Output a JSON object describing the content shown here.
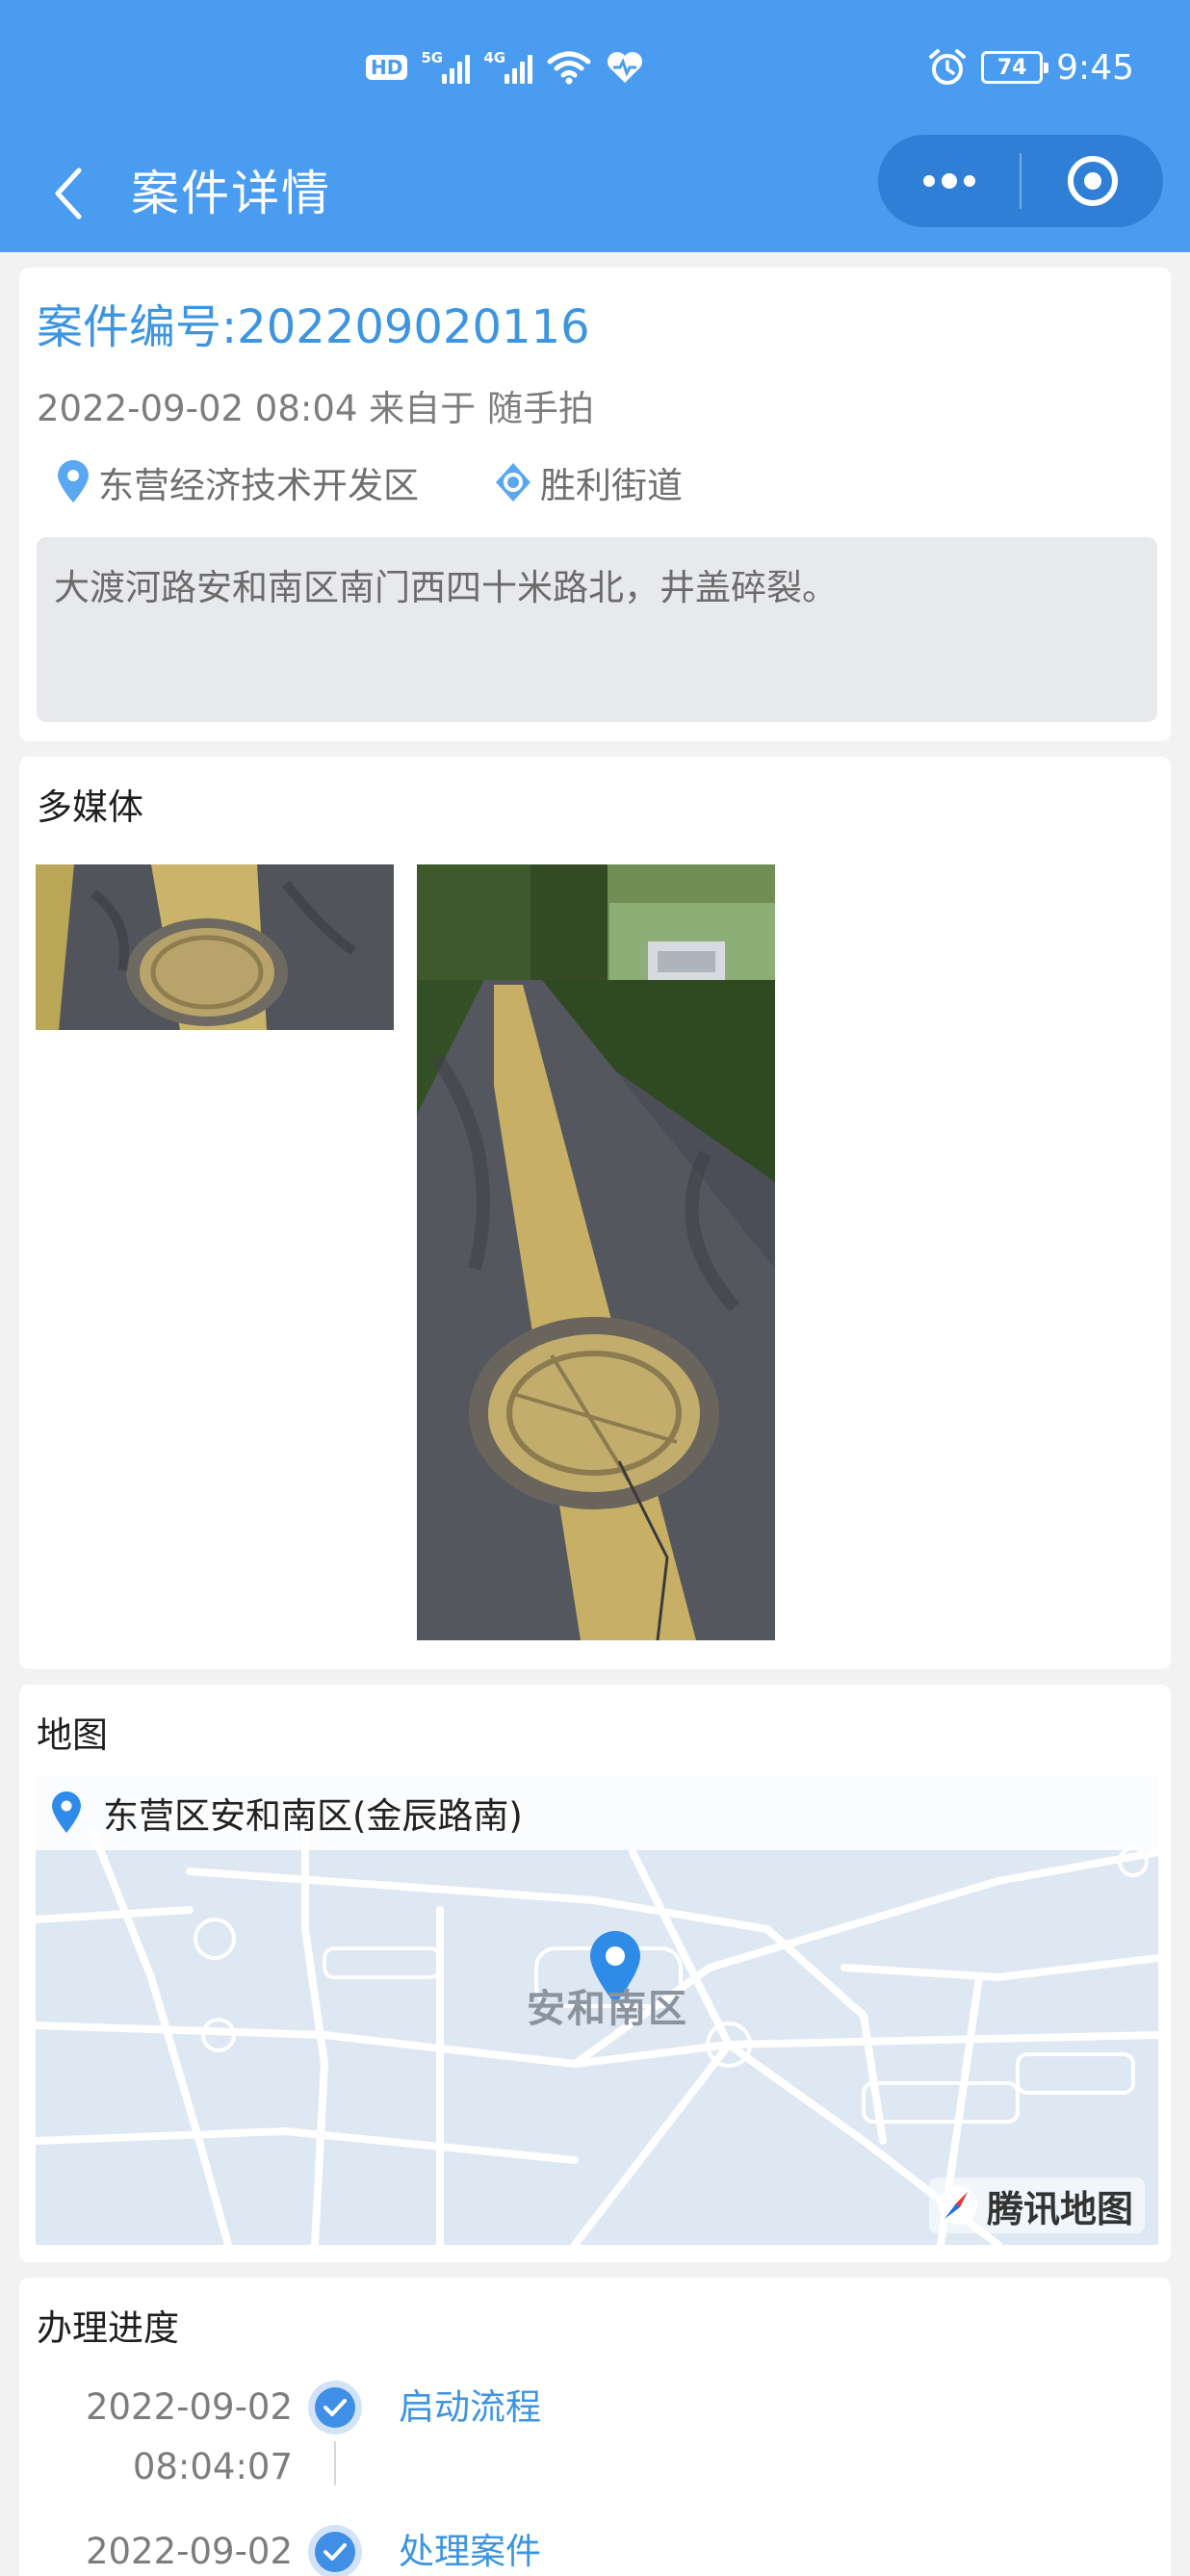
{
  "status_bar": {
    "hd_label": "HD",
    "sim1_tag": "5G",
    "sim2_tag": "4G",
    "battery": "74",
    "time": "9:45"
  },
  "nav": {
    "title": "案件详情"
  },
  "case": {
    "number_label": "案件编号:202209020116",
    "meta": "2022-09-02 08:04 来自于 随手拍",
    "district": "东营经济技术开发区",
    "street": "胜利街道",
    "description": "大渡河路安和南区南门西四十米路北，井盖碎裂。"
  },
  "media": {
    "title": "多媒体"
  },
  "map": {
    "title": "地图",
    "address": "东营区安和南区(金辰路南)",
    "place_label": "安和南区",
    "logo_text": "腾讯地图"
  },
  "progress": {
    "title": "办理进度",
    "steps": [
      {
        "date": "2022-09-02",
        "time": "08:04:07",
        "label": "启动流程"
      },
      {
        "date": "2022-09-02",
        "time": "",
        "label": "处理案件"
      }
    ]
  },
  "colors": {
    "header": "#4a9cf0",
    "accent": "#3d95e0",
    "capsule": "#2f7fd6"
  }
}
